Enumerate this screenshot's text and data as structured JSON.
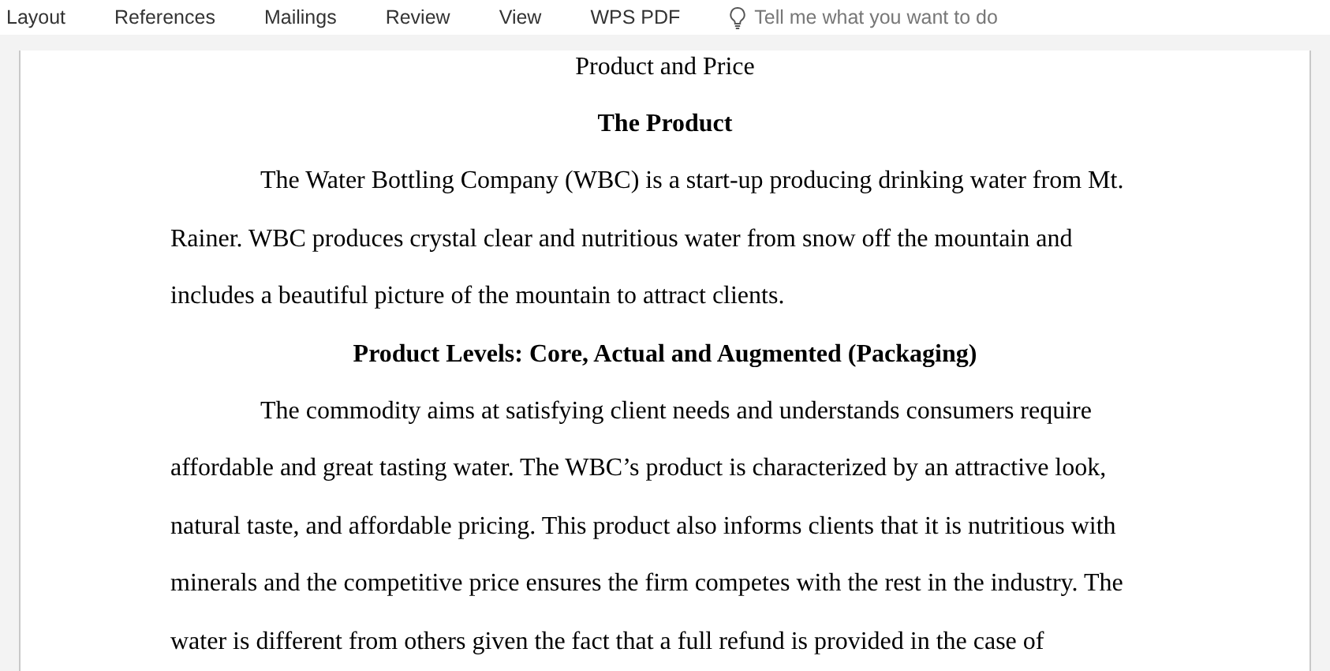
{
  "ribbon": {
    "tabs": [
      {
        "label": "Layout"
      },
      {
        "label": "References"
      },
      {
        "label": "Mailings"
      },
      {
        "label": "Review"
      },
      {
        "label": "View"
      },
      {
        "label": "WPS PDF"
      }
    ],
    "tell_me": {
      "placeholder": "Tell me what you want to do"
    }
  },
  "document": {
    "blocks": [
      {
        "kind": "title",
        "text": "Product and Price"
      },
      {
        "kind": "heading",
        "text": "The Product"
      },
      {
        "kind": "paragraph",
        "lines": [
          "The Water Bottling Company (WBC) is a start-up producing drinking water from Mt.",
          "Rainer. WBC produces crystal clear and nutritious water from snow off the mountain and",
          "includes a beautiful picture of the mountain to attract clients."
        ]
      },
      {
        "kind": "heading",
        "text": "Product Levels: Core, Actual and Augmented (Packaging)"
      },
      {
        "kind": "paragraph",
        "lines": [
          "The commodity aims at satisfying client needs and understands consumers require",
          "affordable and great tasting water. The WBC’s product is characterized by an attractive look,",
          "natural taste, and affordable pricing. This product also informs clients that it is nutritious with",
          "minerals and the competitive price ensures the firm competes with the rest in the industry. The",
          "water is different from others given the fact that a full refund is provided in the case of"
        ]
      }
    ]
  }
}
